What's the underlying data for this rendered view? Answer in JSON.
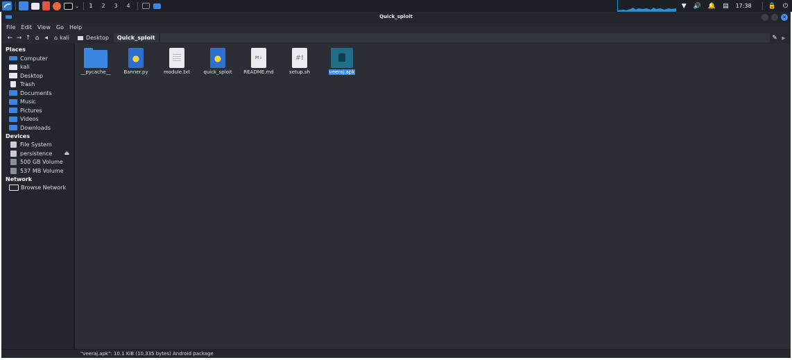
{
  "taskbar": {
    "workspaces": [
      "1",
      "2",
      "3",
      "4"
    ],
    "clock": "17:38"
  },
  "window": {
    "title": "Quick_sploit"
  },
  "menubar": {
    "items": [
      "File",
      "Edit",
      "View",
      "Go",
      "Help"
    ]
  },
  "pathbar": {
    "crumbs": [
      "kali",
      "Desktop",
      "Quick_sploit"
    ]
  },
  "sidebar": {
    "sections": [
      {
        "heading": "Places",
        "items": [
          "Computer",
          "kali",
          "Desktop",
          "Trash",
          "Documents",
          "Music",
          "Pictures",
          "Videos",
          "Downloads"
        ]
      },
      {
        "heading": "Devices",
        "items": [
          "File System",
          "persistence",
          "500 GB Volume",
          "537 MB Volume"
        ]
      },
      {
        "heading": "Network",
        "items": [
          "Browse Network"
        ]
      }
    ]
  },
  "files": [
    {
      "name": "__pycache__",
      "icon": "folder-icon"
    },
    {
      "name": "Banner.py",
      "icon": "python-file-icon"
    },
    {
      "name": "module.txt",
      "icon": "text-file-icon"
    },
    {
      "name": "quick_sploit",
      "icon": "python-file-icon"
    },
    {
      "name": "README.md",
      "icon": "markdown-file-icon"
    },
    {
      "name": "setup.sh",
      "icon": "shell-script-icon"
    },
    {
      "name": "veeraj.apk",
      "icon": "apk-package-icon",
      "selected": true
    }
  ],
  "statusbar": {
    "text": "\"veeraj.apk\": 10.1 KiB (10,335 bytes) Android package"
  },
  "colors": {
    "accent": "#3a86e0",
    "background": "#2b2e35",
    "sidebar": "#23262d"
  }
}
